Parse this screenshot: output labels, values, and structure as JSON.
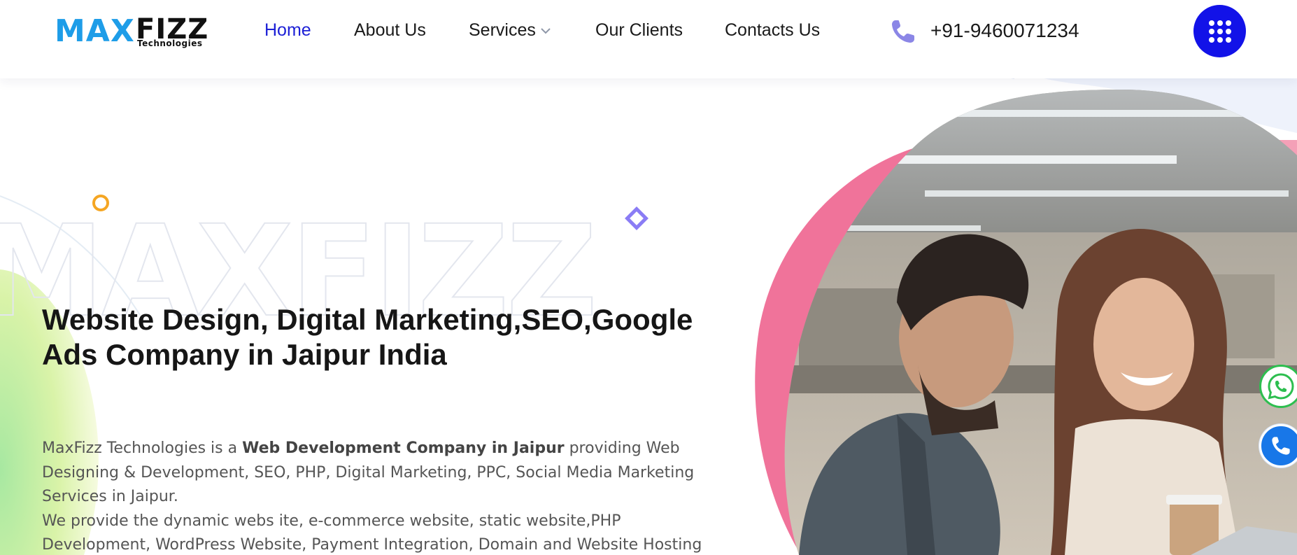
{
  "logo": {
    "primary": "MAX",
    "secondary": "FIZZ",
    "tagline": "Technologies"
  },
  "nav": {
    "items": [
      {
        "label": "Home",
        "active": true
      },
      {
        "label": "About Us",
        "active": false
      },
      {
        "label": "Services",
        "active": false,
        "icon": "chevron-down-icon"
      },
      {
        "label": "Our Clients",
        "active": false
      },
      {
        "label": "Contacts Us",
        "active": false
      }
    ]
  },
  "contact": {
    "phone": "+91-9460071234",
    "icon": "phone-icon"
  },
  "menu_button": {
    "icon": "grid-menu-icon"
  },
  "hero": {
    "watermark": "MAXFIZZ",
    "title": "Website Design, Digital Marketing,SEO,Google Ads Company in Jaipur India",
    "para1_pre": "MaxFizz Technologies is a ",
    "para1_bold": "Web Development Company in Jaipur",
    "para1_post": " providing Web Designing & Development, SEO, PHP, Digital Marketing, PPC, Social Media Marketing Services in Jaipur.",
    "para2": "We provide the dynamic webs ite, e-commerce website, static website,PHP Development, WordPress Website, Payment Integration, Domain and Website Hosting"
  },
  "floating": {
    "whatsapp_icon": "whatsapp-icon",
    "call_icon": "phone-call-icon"
  },
  "colors": {
    "brand_blue": "#1e9de8",
    "nav_active": "#1c1fd6",
    "menu_button": "#1212e8",
    "pink_blob": "#f0739a",
    "whatsapp": "#2dbe4f",
    "call": "#1877e8"
  }
}
